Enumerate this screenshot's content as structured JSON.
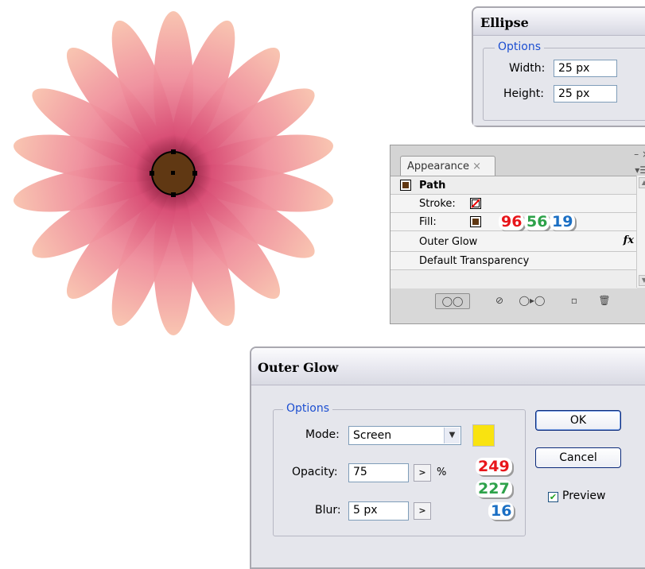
{
  "ellipse_dialog": {
    "title": "Ellipse",
    "options_label": "Options",
    "width_label": "Width:",
    "width_value": "25 px",
    "height_label": "Height:",
    "height_value": "25 px"
  },
  "appearance_panel": {
    "tab_label": "Appearance",
    "tab_close": "×",
    "rows": {
      "path": "Path",
      "stroke": "Stroke:",
      "fill": "Fill:",
      "outer_glow": "Outer Glow",
      "default_transparency": "Default Transparency"
    },
    "fx": "fx",
    "fill_rgb": {
      "r": "96",
      "g": "56",
      "b": "19"
    },
    "fill_color": "#603813",
    "panel_controls": "– ×",
    "panel_menu": "▾☰"
  },
  "outer_glow_dialog": {
    "title": "Outer Glow",
    "options_label": "Options",
    "mode_label": "Mode:",
    "mode_value": "Screen",
    "opacity_label": "Opacity:",
    "opacity_value": "75",
    "opacity_unit": "%",
    "blur_label": "Blur:",
    "blur_value": "5 px",
    "glow_rgb": {
      "r": "249",
      "g": "227",
      "b": "16"
    },
    "glow_color": "#f9e310",
    "ok_label": "OK",
    "cancel_label": "Cancel",
    "preview_label": "Preview",
    "preview_checked": true
  },
  "colors": {
    "red_badge": "#e8161b",
    "green_badge": "#2ea24a",
    "blue_badge": "#1b6fc4",
    "petal_light": "#f7b8a6",
    "petal_dark": "#d94f76",
    "center": "#603813"
  },
  "icons": [
    "chevron-down-icon",
    "chevron-right-icon",
    "close-icon",
    "fx-icon",
    "new-art-icon",
    "clear-icon",
    "reduce-icon",
    "duplicate-icon",
    "trash-icon",
    "check-icon"
  ]
}
